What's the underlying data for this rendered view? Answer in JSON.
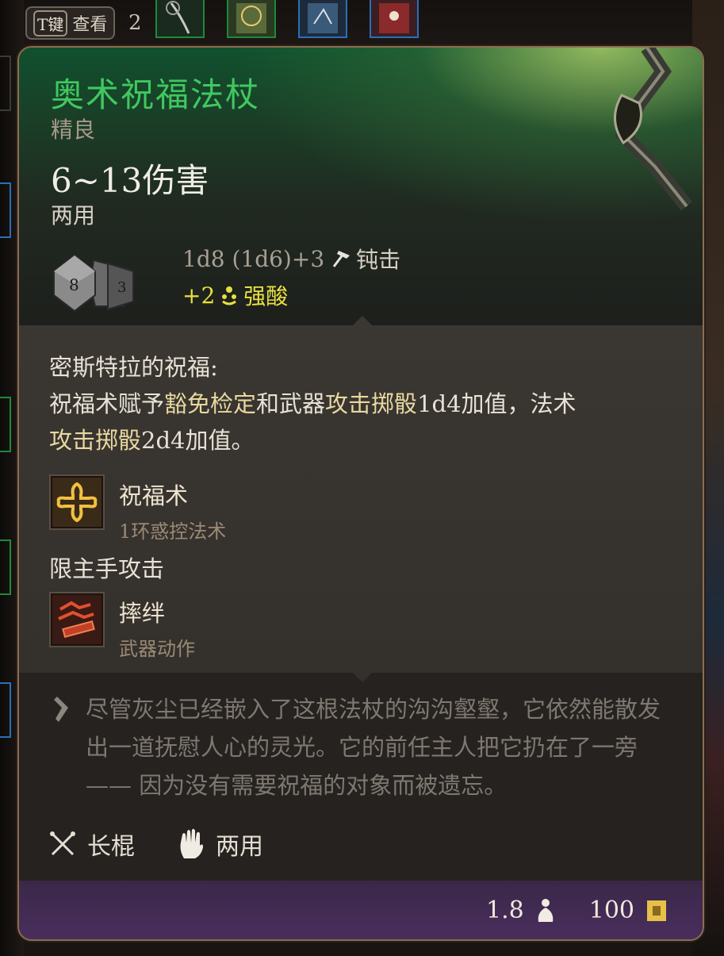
{
  "hotbar": {
    "key_label": "T键",
    "view_label": "查看",
    "count": "2",
    "slot_colors": [
      "#1e8a3a",
      "#1e8a3a",
      "#2a6fb8",
      "#2a6fb8"
    ]
  },
  "item": {
    "name": "奥术祝福法杖",
    "rarity": "精良",
    "damage_range": "6~13伤害",
    "handedness": "两用",
    "dice_icon": "d8-d6-dice-icon",
    "damage_base": "1d8 (1d6)+3",
    "damage_base_type_icon": "hammer-icon",
    "damage_base_type": "钝击",
    "damage_bonus": "+2",
    "damage_bonus_type_icon": "acid-icon",
    "damage_bonus_type": "强酸"
  },
  "blessing": {
    "title": "密斯特拉的祝福:",
    "desc_1": "祝福术赋予",
    "desc_hl_1": "豁免检定",
    "desc_2": "和武器",
    "desc_hl_2": "攻击掷骰",
    "desc_3": "1d4加值，法术",
    "desc_hl_3": "攻击掷骰",
    "desc_4": "2d4加值。"
  },
  "abilities": [
    {
      "icon": "bless-cross-icon",
      "name": "祝福术",
      "sub": "1环惑控法术"
    },
    {
      "icon": "topple-icon",
      "name": "摔绊",
      "sub": "武器动作"
    }
  ],
  "restriction": "限主手攻击",
  "lore": {
    "icon": "quote-icon",
    "text": "尽管灰尘已经嵌入了这根法杖的沟沟壑壑，它依然能散发出一道抚慰人心的灵光。它的前任主人把它扔在了一旁 —— 因为没有需要祝福的对象而被遗忘。"
  },
  "properties": [
    {
      "icon": "quarterstaff-icon",
      "label": "长棍"
    },
    {
      "icon": "two-hand-icon",
      "label": "两用"
    }
  ],
  "footer": {
    "weight": "1.8",
    "weight_icon": "weight-icon",
    "value": "100",
    "value_icon": "gold-icon"
  },
  "colors": {
    "title": "#40c860",
    "bonus": "#e8e040",
    "border": "#8a6e52",
    "footer": "#4a2e5e"
  }
}
